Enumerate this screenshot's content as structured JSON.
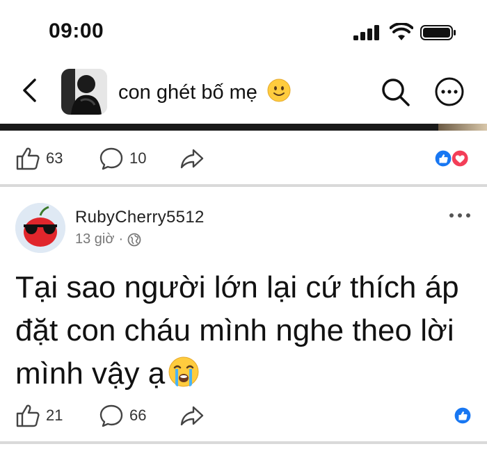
{
  "status_bar": {
    "time": "09:00"
  },
  "header": {
    "back_icon": "chevron-left-icon",
    "group_name": "con ghét bố mẹ",
    "group_emoji": "slightly-smiling-face-emoji",
    "search_icon": "search-icon",
    "more_icon": "more-horizontal-icon"
  },
  "previous_post": {
    "likes": "63",
    "comments": "10",
    "reactions": [
      "like",
      "love"
    ]
  },
  "post": {
    "author": "RubyCherry5512",
    "time": "13 giờ",
    "separator": "·",
    "privacy_icon": "globe-icon",
    "text": "Tại sao người lớn lại cứ thích áp đặt con cháu mình nghe theo lời mình vậy ạ",
    "text_emoji": "crying-face-emoji",
    "likes": "21",
    "comments": "66",
    "reactions": [
      "like"
    ]
  },
  "colors": {
    "like_blue": "#1877F2",
    "love_red": "#F33E58",
    "divider": "#D9D9D9",
    "text_secondary": "#777777"
  }
}
